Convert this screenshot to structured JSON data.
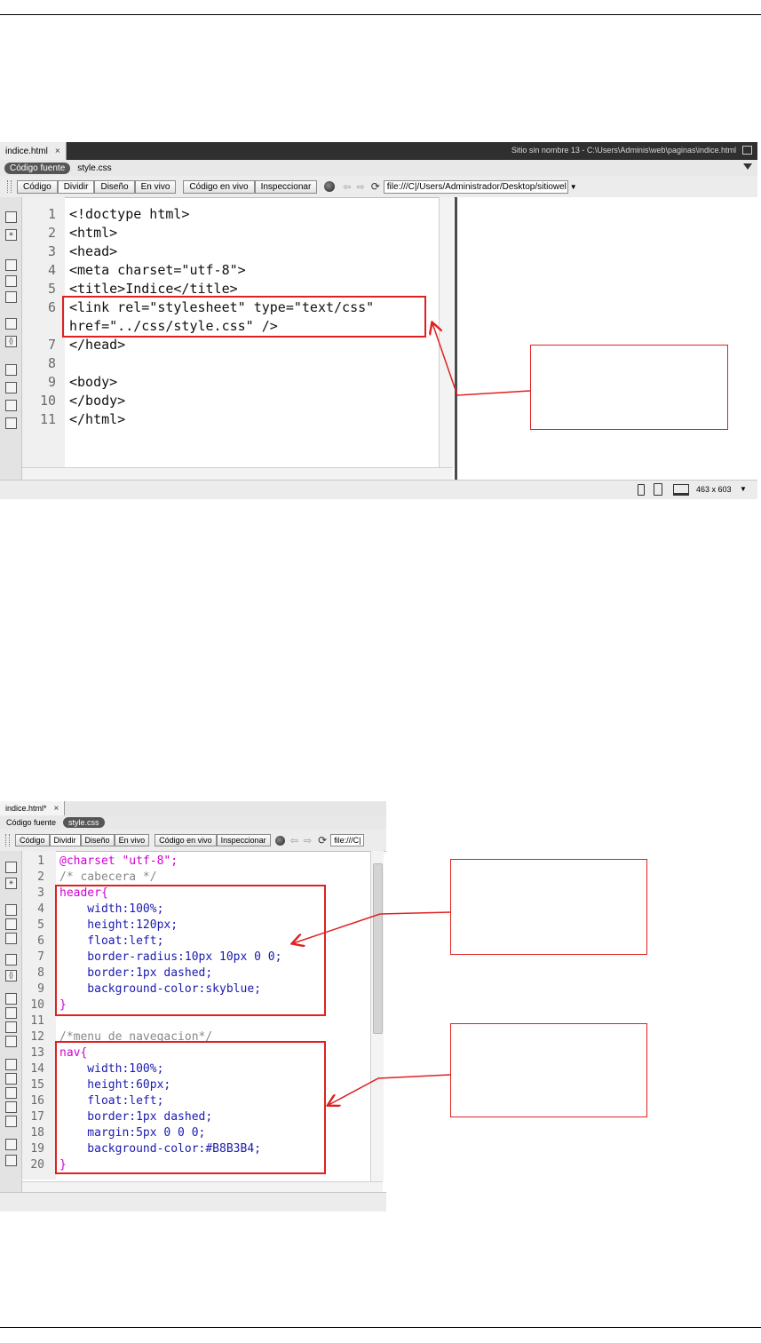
{
  "top_panel": {
    "tab": {
      "label": "indice.html",
      "close": "×"
    },
    "site_path": "Sitio sin nombre 13 - C:\\Users\\Adminis\\web\\paginas\\indice.html",
    "files": {
      "source": "Código fuente",
      "related": "style.css"
    },
    "toolbar": {
      "code": "Código",
      "split": "Dividir",
      "design": "Diseño",
      "live": "En vivo",
      "live_code": "Código en vivo",
      "inspect": "Inspeccionar",
      "url": "file:///C|/Users/Administrador/Desktop/sitiowel"
    },
    "line_numbers": [
      "1",
      "2",
      "3",
      "4",
      "5",
      "6",
      "",
      "7",
      "8",
      "9",
      "10",
      "11"
    ],
    "code_lines": [
      "<!doctype html>",
      "<html>",
      "<head>",
      "<meta charset=\"utf-8\">",
      "<title>Indice</title>",
      "<link rel=\"stylesheet\" type=\"text/css\"",
      "href=\"../css/style.css\" />",
      "</head>",
      "",
      "<body>",
      "</body>",
      "</html>"
    ],
    "status": {
      "size": "463 x 603"
    }
  },
  "bottom_panel": {
    "tab": {
      "label": "indice.html*",
      "close": "×"
    },
    "files": {
      "source": "Código fuente",
      "related": "style.css"
    },
    "toolbar": {
      "code": "Código",
      "split": "Dividir",
      "design": "Diseño",
      "live": "En vivo",
      "live_code": "Código en vivo",
      "inspect": "Inspeccionar",
      "url": "file:///C|"
    },
    "line_numbers": [
      "1",
      "2",
      "3",
      "4",
      "5",
      "6",
      "7",
      "8",
      "9",
      "10",
      "11",
      "12",
      "13",
      "14",
      "15",
      "16",
      "17",
      "18",
      "19",
      "20"
    ],
    "code_lines": [
      "@charset \"utf-8\";",
      "/* cabecera */",
      "header{",
      "    width:100%;",
      "    height:120px;",
      "    float:left;",
      "    border-radius:10px 10px 0 0;",
      "    border:1px dashed;",
      "    background-color:skyblue;",
      "}",
      "",
      "/*menu de navegacion*/",
      "nav{",
      "    width:100%;",
      "    height:60px;",
      "    float:left;",
      "    border:1px dashed;",
      "    margin:5px 0 0 0;",
      "    background-color:#B8B3B4;",
      "}"
    ]
  },
  "colors": {
    "annotation": "#e02020",
    "selector": "#d000d0",
    "property": "#1a1ab0",
    "comment": "#888888"
  }
}
